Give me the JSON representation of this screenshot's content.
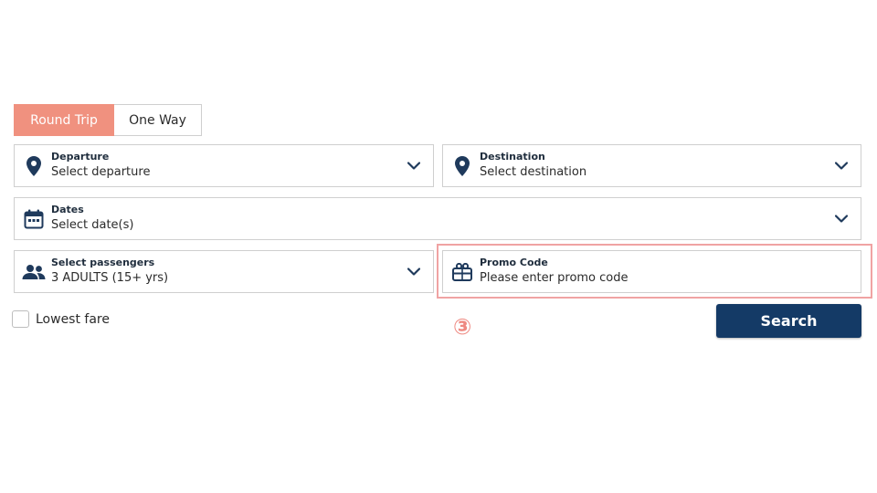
{
  "trip_toggle": {
    "round_trip": "Round Trip",
    "one_way": "One Way",
    "selected": "Round Trip"
  },
  "departure": {
    "label": "Departure",
    "value": "Select departure",
    "icon": "location-pin-icon"
  },
  "destination": {
    "label": "Destination",
    "value": "Select destination",
    "icon": "location-pin-icon"
  },
  "dates": {
    "label": "Dates",
    "value": "Select date(s)",
    "icon": "calendar-icon"
  },
  "passengers": {
    "label": "Select passengers",
    "value": "3 ADULTS (15+ yrs)",
    "icon": "people-icon"
  },
  "promo": {
    "label": "Promo Code",
    "placeholder": "Please enter promo code",
    "value": "",
    "icon": "ticket-icon"
  },
  "lowest_fare": {
    "label": "Lowest fare",
    "checked": false
  },
  "annotation": {
    "marker": "③"
  },
  "search": {
    "label": "Search"
  },
  "colors": {
    "accent": "#f0917f",
    "primary": "#143a66",
    "icon": "#1f3a5c",
    "highlight": "#f0a3a3"
  }
}
